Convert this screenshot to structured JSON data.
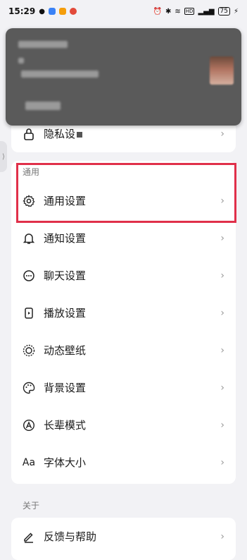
{
  "status_bar": {
    "time": "15:29",
    "battery": "75"
  },
  "privacy_row": {
    "label": "隐私设"
  },
  "general": {
    "section_title": "通用",
    "items": [
      {
        "label": "通用设置"
      },
      {
        "label": "通知设置"
      },
      {
        "label": "聊天设置"
      },
      {
        "label": "播放设置"
      },
      {
        "label": "动态壁纸"
      },
      {
        "label": "背景设置"
      },
      {
        "label": "长辈模式"
      },
      {
        "label": "字体大小"
      }
    ],
    "font_icon_text": "Aa"
  },
  "about": {
    "section_title": "关于",
    "items": [
      {
        "label": "反馈与帮助"
      }
    ]
  },
  "colors": {
    "highlight": "#e0304a",
    "background": "#f2f2f5"
  }
}
